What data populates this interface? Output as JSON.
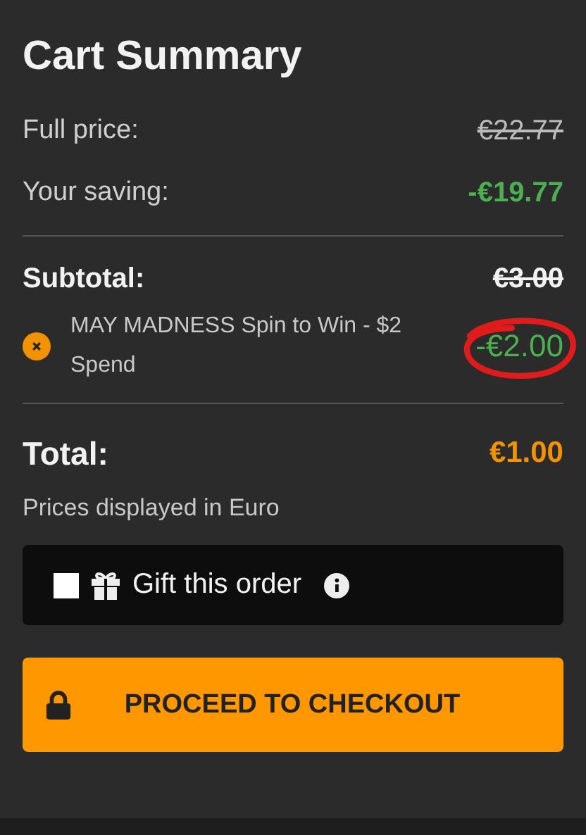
{
  "title": "Cart Summary",
  "price_rows": [
    {
      "label": "Full price:",
      "value": "€22.77",
      "struck": true,
      "kind": "plain"
    },
    {
      "label": "Your saving:",
      "value": "-€19.77",
      "struck": false,
      "kind": "saving"
    }
  ],
  "subtotal": {
    "label": "Subtotal:",
    "value": "€3.00",
    "struck": true
  },
  "discounts": [
    {
      "name": "MAY MADNESS Spin to Win - $2 Spend",
      "value": "-€2.00",
      "circled": true
    }
  ],
  "total": {
    "label": "Total:",
    "value": "€1.00"
  },
  "note": "Prices displayed in Euro",
  "gift": {
    "label": "Gift this order",
    "checked": false
  },
  "checkout_button": "PROCEED TO CHECKOUT"
}
